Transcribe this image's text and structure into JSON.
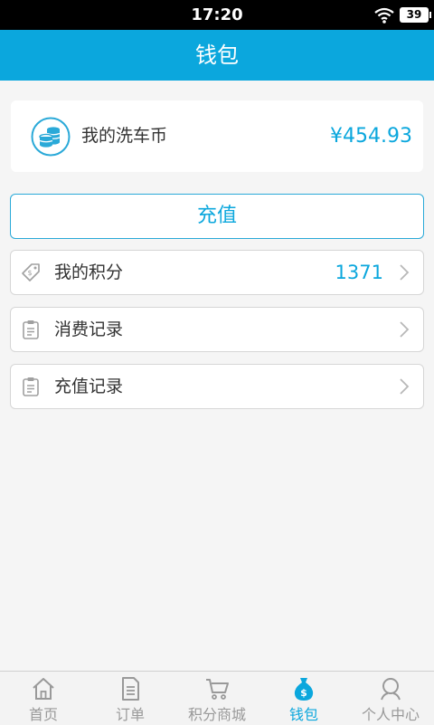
{
  "status_bar": {
    "time": "17:20",
    "battery": "39"
  },
  "nav": {
    "title": "钱包"
  },
  "balance": {
    "label": "我的洗车币",
    "value": "¥454.93",
    "icon": "coins-icon"
  },
  "recharge": {
    "label": "充值"
  },
  "menu": {
    "points": {
      "label": "我的积分",
      "value": "1371",
      "icon": "tag-icon"
    },
    "consumption": {
      "label": "消费记录",
      "icon": "clipboard-icon"
    },
    "recharge_records": {
      "label": "充值记录",
      "icon": "clipboard-icon"
    }
  },
  "tabs": [
    {
      "label": "首页",
      "icon": "home-icon"
    },
    {
      "label": "订单",
      "icon": "document-icon"
    },
    {
      "label": "积分商城",
      "icon": "cart-icon"
    },
    {
      "label": "钱包",
      "icon": "money-bag-icon",
      "active": true
    },
    {
      "label": "个人中心",
      "icon": "person-icon"
    }
  ],
  "colors": {
    "accent": "#0ba7dd",
    "background": "#f5f5f5",
    "tab_inactive": "#999999"
  }
}
